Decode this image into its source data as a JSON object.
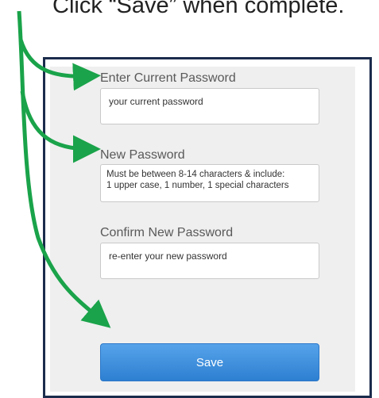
{
  "instruction": "Click “Save” when complete.",
  "form": {
    "current_password": {
      "label": "Enter Current Password",
      "placeholder": "your current password"
    },
    "new_password": {
      "label": "New Password",
      "hint_line1": "Must be between 8-14 characters & include:",
      "hint_line2": "1 upper case, 1 number, 1 special characters"
    },
    "confirm_password": {
      "label": "Confirm New Password",
      "placeholder": "re-enter your new password"
    },
    "save_label": "Save"
  },
  "colors": {
    "arrow": "#1aa34a",
    "frame": "#1b2c4c",
    "button": "#3d8fdd"
  }
}
